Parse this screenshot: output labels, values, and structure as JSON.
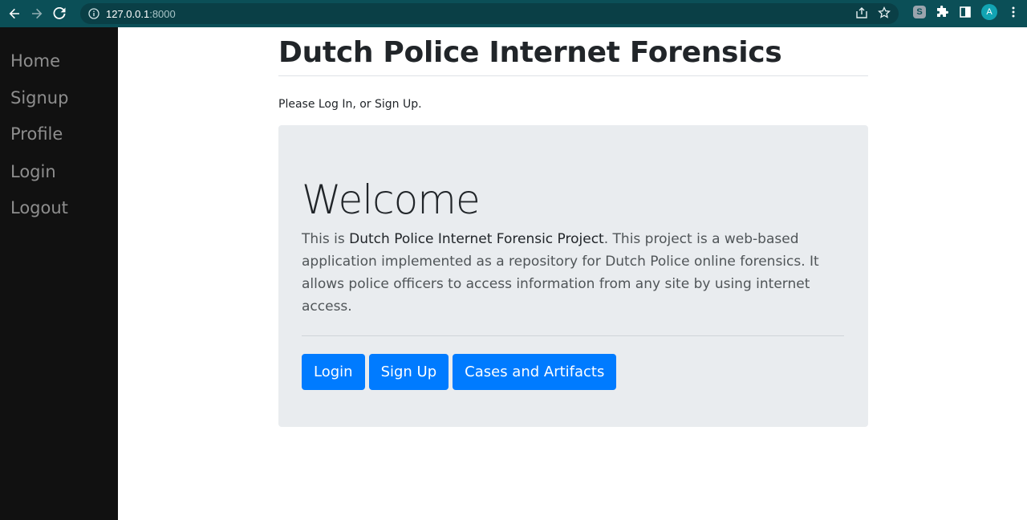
{
  "browser": {
    "url_host": "127.0.0.1",
    "url_port": ":8000",
    "avatar_letter": "A",
    "extension_letter": "S"
  },
  "sidebar": {
    "items": [
      {
        "label": "Home"
      },
      {
        "label": "Signup"
      },
      {
        "label": "Profile"
      },
      {
        "label": "Login"
      },
      {
        "label": "Logout"
      }
    ]
  },
  "main": {
    "title": "Dutch Police Internet Forensics",
    "intro": "Please Log In, or Sign Up.",
    "jumbotron": {
      "heading": "Welcome",
      "lead_prefix": "This is ",
      "lead_project": "Dutch Police Internet Forensic Project",
      "lead_rest": ". This project is a web-based application implemented as a repository for Dutch Police online forensics. It allows police officers to access information from any site by using internet access.",
      "buttons": {
        "login": "Login",
        "signup": "Sign Up",
        "cases": "Cases and Artifacts"
      }
    }
  },
  "colors": {
    "chrome": "#0b4f57",
    "sidebar": "#111111",
    "primary": "#007bff",
    "jumbotron": "#e9ecef"
  }
}
